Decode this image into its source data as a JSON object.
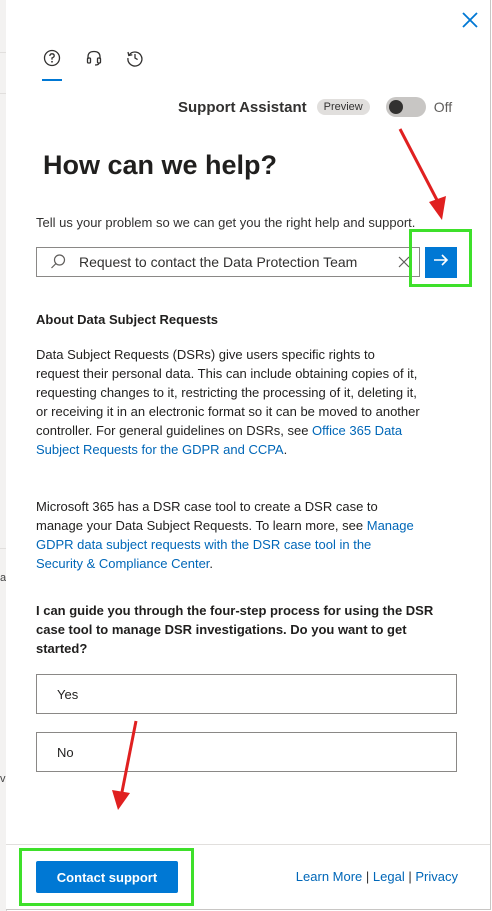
{
  "background_page": {
    "edge_chars": [
      "a",
      "v"
    ]
  },
  "header": {
    "tabs": [
      {
        "icon": "help-circle-icon"
      },
      {
        "icon": "headset-icon"
      },
      {
        "icon": "history-icon"
      }
    ],
    "close_icon": "close-icon"
  },
  "assistant": {
    "label": "Support Assistant",
    "badge": "Preview",
    "toggle_state": "Off",
    "toggle_on": false
  },
  "main": {
    "heading": "How can we help?",
    "prompt": "Tell us your problem so we can get you the right help and support.",
    "search": {
      "value": "Request to contact the Data Protection Team",
      "placeholder": ""
    },
    "about_title": "About Data Subject Requests",
    "para1": {
      "text": "Data Subject Requests (DSRs) give users specific rights to request their personal data. This can include obtaining copies of it, requesting changes to it, restricting the processing of it, deleting it, or receiving it in an electronic format so it can be moved to another controller. For general guidelines on DSRs, see ",
      "link": "Office 365 Data Subject Requests for the GDPR and CCPA",
      "tail": "."
    },
    "para2": {
      "text": "Microsoft 365 has a DSR case tool to create a DSR case to manage your Data Subject Requests. To learn more, see ",
      "link": "Manage GDPR data subject requests with the DSR case tool in the Security & Compliance Center",
      "tail": "."
    },
    "guide_question": "I can guide you through the four-step process for using the DSR case tool to manage DSR investigations. Do you want to get started?",
    "choices": [
      "Yes",
      "No"
    ]
  },
  "footer": {
    "contact_button": "Contact support",
    "links": [
      "Learn More",
      "Legal",
      "Privacy"
    ],
    "separator": "|"
  },
  "colors": {
    "accent": "#0078d4",
    "link": "#0067b8",
    "highlight": "#3ee02a",
    "annotation_arrow": "#e02020"
  }
}
